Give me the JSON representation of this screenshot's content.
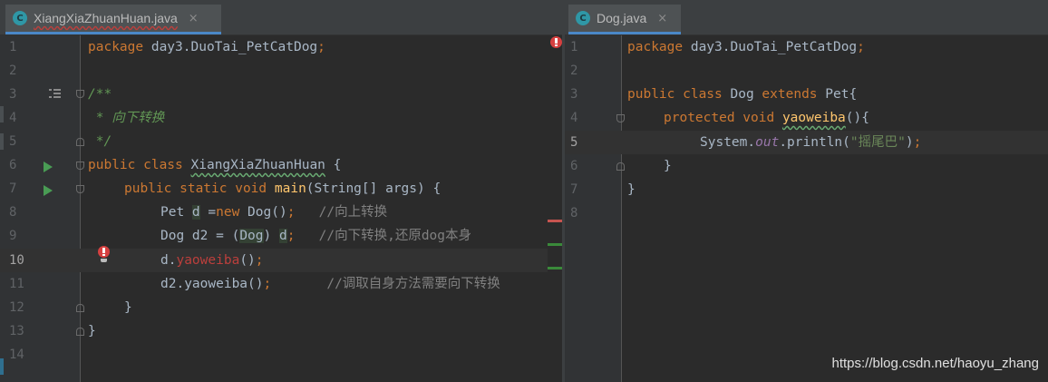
{
  "left": {
    "tab": {
      "title": "XiangXiaZhuanHuan.java",
      "close": "×",
      "icon_letter": "C"
    },
    "line_numbers": [
      "1",
      "2",
      "3",
      "4",
      "5",
      "6",
      "7",
      "8",
      "9",
      "10",
      "11",
      "12",
      "13",
      "14"
    ],
    "current_line": "10",
    "code": {
      "l1_kw": "package",
      "l1_rest": " day3.DuoTai_PetCatDog",
      "l1_semi": ";",
      "l3": "/**",
      "l4": " * 向下转换",
      "l5": " */",
      "l6_kw": "public class",
      "l6_sp": " ",
      "l6_name": "XiangXiaZhuanHuan",
      "l6_rest": " {",
      "l7_kw": "public static void",
      "l7_sp": " ",
      "l7_fn": "main",
      "l7_rest": "(String[] args) {",
      "l8_a": "Pet ",
      "l8_var": "d",
      "l8_b": " =",
      "l8_kw": "new",
      "l8_c": " Dog()",
      "l8_semi": ";",
      "l8_cm": "   //向上转换",
      "l9_a": "Dog d2 = (",
      "l9_cast": "Dog",
      "l9_b": ") ",
      "l9_d": "d",
      "l9_semi": ";",
      "l9_cm": "   //向下转换,还原dog本身",
      "l10_a": "d.",
      "l10_err": "yaoweiba",
      "l10_b": "()",
      "l10_semi": ";",
      "l11_a": "d2.yaoweiba()",
      "l11_semi": ";",
      "l11_cm": "       //调取自身方法需要向下转换",
      "l12": "}",
      "l13": "}"
    }
  },
  "right": {
    "tab": {
      "title": "Dog.java",
      "close": "×",
      "icon_letter": "C"
    },
    "line_numbers": [
      "1",
      "2",
      "3",
      "4",
      "5",
      "6",
      "7",
      "8"
    ],
    "current_line": "5",
    "code": {
      "l1_kw": "package",
      "l1_rest": " day3.DuoTai_PetCatDog",
      "l1_semi": ";",
      "l3_kw": "public class",
      "l3_a": " Dog ",
      "l3_kw2": "extends",
      "l3_b": " Pet{",
      "l4_kw": "protected void",
      "l4_sp": " ",
      "l4_fn": "yaoweiba",
      "l4_rest": "(){",
      "l5_a": "System.",
      "l5_out": "out",
      "l5_b": ".println(",
      "l5_str": "\"摇尾巴\"",
      "l5_c": ")",
      "l5_semi": ";",
      "l6": "}",
      "l7": "}"
    }
  },
  "watermark": "https://blog.csdn.net/haoyu_zhang"
}
